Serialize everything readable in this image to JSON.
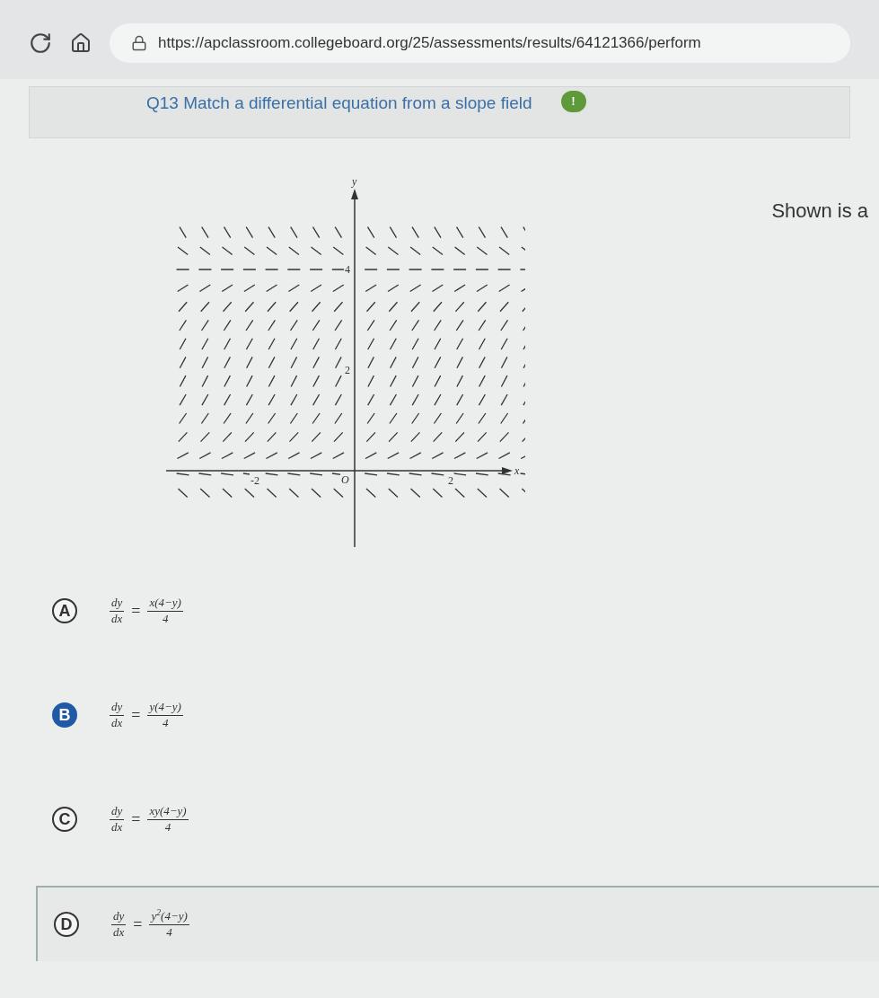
{
  "browser": {
    "url": "https://apclassroom.collegeboard.org/25/assessments/results/64121366/perform"
  },
  "question": {
    "title": "Q13 Match a differential equation from a slope field",
    "status": "!",
    "prompt": "Shown is a"
  },
  "slope_field": {
    "y_axis_label": "y",
    "x_axis_label": "x",
    "origin_label": "O",
    "y_ticks": [
      "4",
      "2"
    ],
    "x_ticks": [
      "-2",
      "2"
    ]
  },
  "options": [
    {
      "letter": "A",
      "selected": false,
      "highlighted": false,
      "lhs_num": "dy",
      "lhs_den": "dx",
      "equals": "=",
      "rhs_num": "x(4−y)",
      "rhs_den": "4"
    },
    {
      "letter": "B",
      "selected": true,
      "highlighted": false,
      "lhs_num": "dy",
      "lhs_den": "dx",
      "equals": "=",
      "rhs_num": "y(4−y)",
      "rhs_den": "4"
    },
    {
      "letter": "C",
      "selected": false,
      "highlighted": false,
      "lhs_num": "dy",
      "lhs_den": "dx",
      "equals": "=",
      "rhs_num": "xy(4−y)",
      "rhs_den": "4"
    },
    {
      "letter": "D",
      "selected": false,
      "highlighted": true,
      "lhs_num": "dy",
      "lhs_den": "dx",
      "equals": "=",
      "rhs_num": "y$^{2}$(4−y)",
      "rhs_den": "4"
    }
  ]
}
